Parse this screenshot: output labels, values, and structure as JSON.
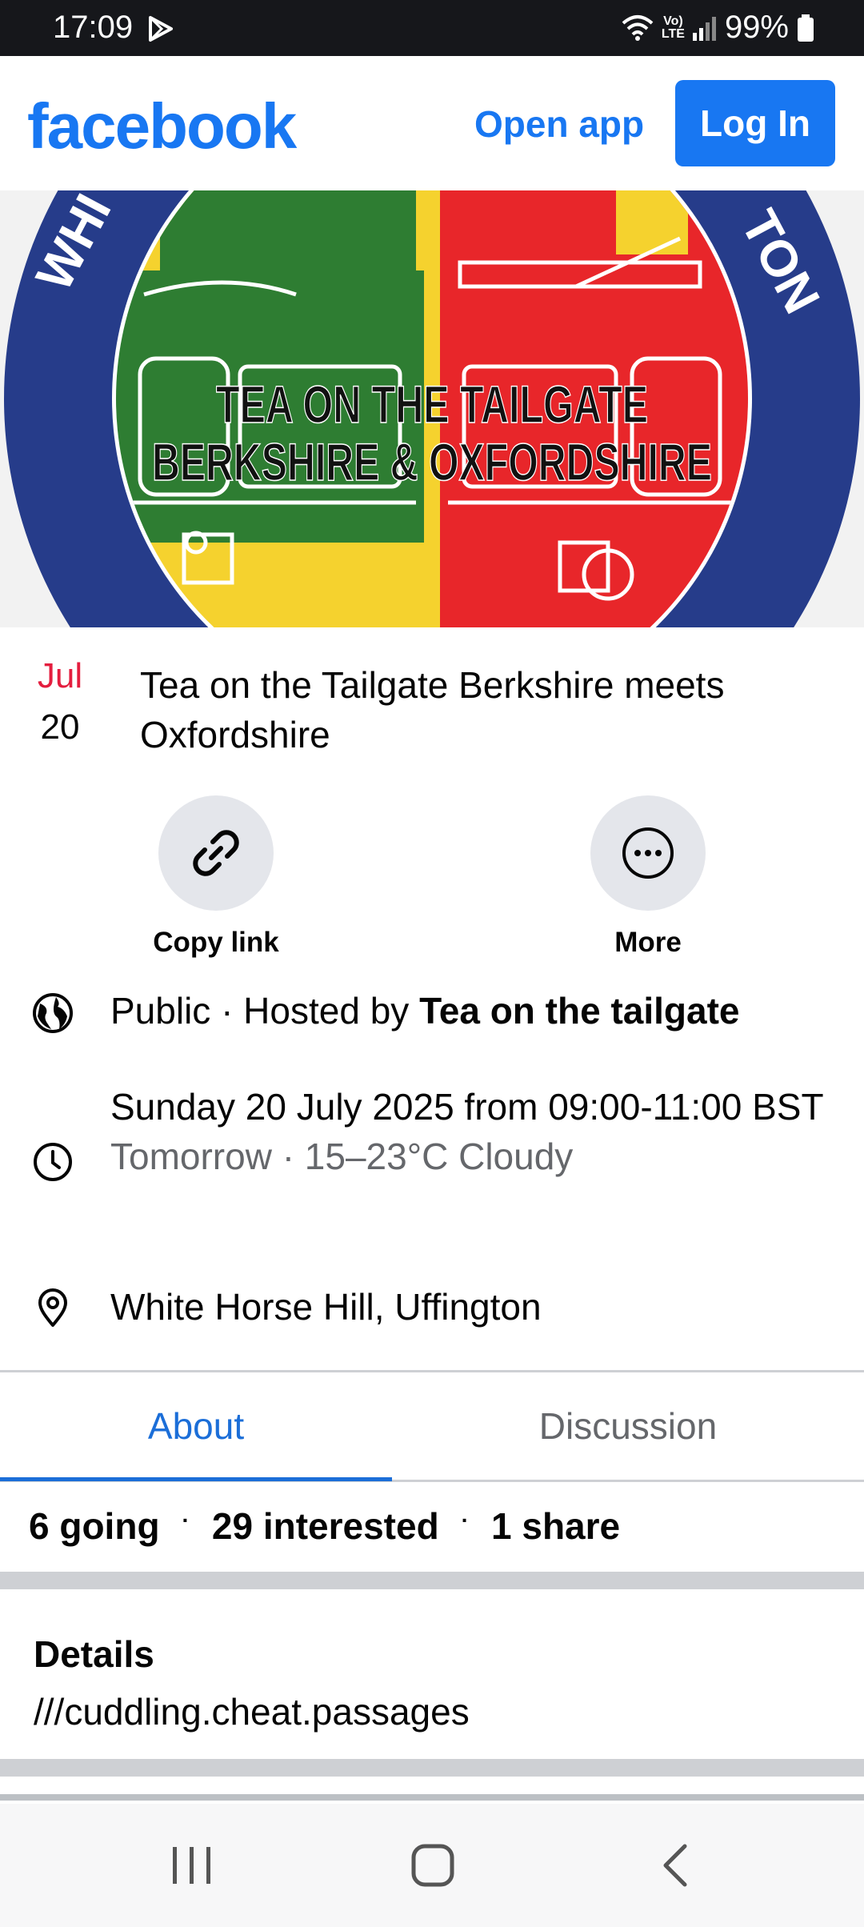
{
  "status_bar": {
    "time": "17:09",
    "lte_label": "Vo)\nLTE",
    "battery": "99%"
  },
  "header": {
    "logo": "facebook",
    "open_app": "Open app",
    "login": "Log In"
  },
  "cover": {
    "line1": "TEA ON THE TAILGATE",
    "line2": "BERKSHIRE & OXFORDSHIRE",
    "ring_left": "WHI",
    "ring_right": "TON"
  },
  "event": {
    "month": "Jul",
    "day": "20",
    "title": "Tea on the Tailgate Berkshire meets Oxfordshire"
  },
  "actions": {
    "copy_link": "Copy link",
    "more": "More"
  },
  "info": {
    "privacy": "Public · Hosted by ",
    "host": "Tea on the tailgate",
    "datetime": "Sunday 20 July 2025 from 09:00-11:00 BST",
    "weather": "Tomorrow · 15–23°C Cloudy",
    "location": "White Horse Hill, Uffington"
  },
  "tabs": {
    "about": "About",
    "discussion": "Discussion"
  },
  "stats": {
    "going": "6 going",
    "interested": "29 interested",
    "shares": "1 share"
  },
  "details": {
    "title": "Details",
    "text": "///cuddling.cheat.passages"
  },
  "colors": {
    "brand": "#1877f2",
    "date_month": "#e41e3f",
    "tab_active": "#1b6ed8",
    "muted": "#65676b"
  }
}
